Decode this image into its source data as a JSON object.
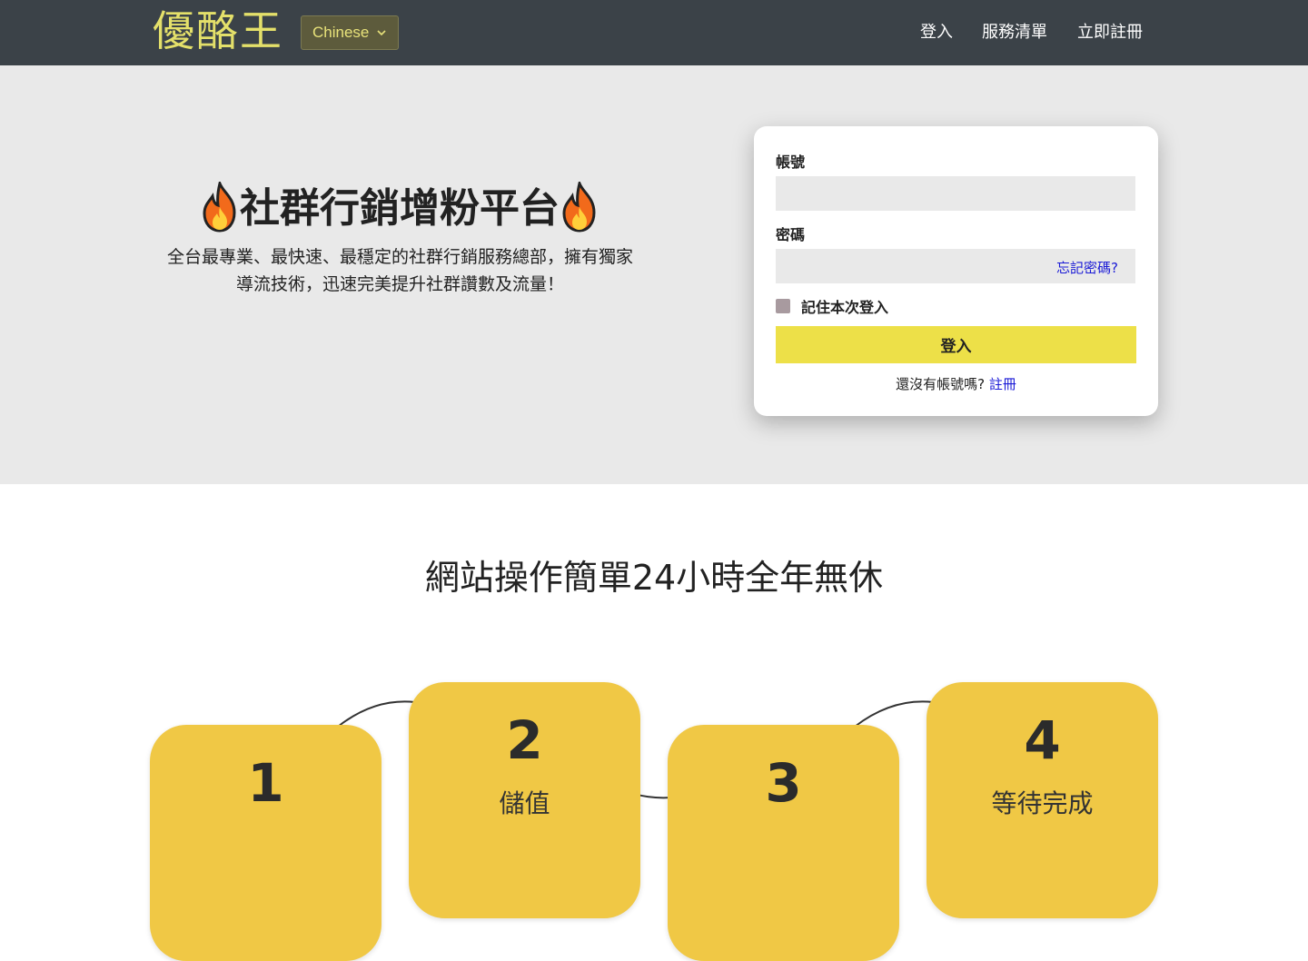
{
  "nav": {
    "logo": "優酪王",
    "language": "Chinese",
    "links": [
      "登入",
      "服務清單",
      "立即註冊"
    ]
  },
  "hero": {
    "title": "社群行銷增粉平台",
    "icon": "fire-icon",
    "subtitle_line1": "全台最專業、最快速、最穩定的社群行銷服務總部，擁有獨家",
    "subtitle_line2": "導流技術，迅速完美提升社群讚數及流量！"
  },
  "login": {
    "account_label": "帳號",
    "password_label": "密碼",
    "forgot_link": "忘記密碼?",
    "remember_label": "記住本次登入",
    "submit_label": "登入",
    "no_account_text": "還沒有帳號嗎?",
    "register_link": "註冊"
  },
  "steps": {
    "title": "網站操作簡單24小時全年無休",
    "items": [
      {
        "number": "1",
        "text": ""
      },
      {
        "number": "2",
        "text": "儲值"
      },
      {
        "number": "3",
        "text": ""
      },
      {
        "number": "4",
        "text": "等待完成"
      }
    ]
  },
  "colors": {
    "navbar": "#3b4248",
    "logo": "#e4e06a",
    "hero_bg": "#e9e9e9",
    "login_button": "#ede048",
    "step_card": "#f0c845",
    "link": "#1a1ad6"
  }
}
